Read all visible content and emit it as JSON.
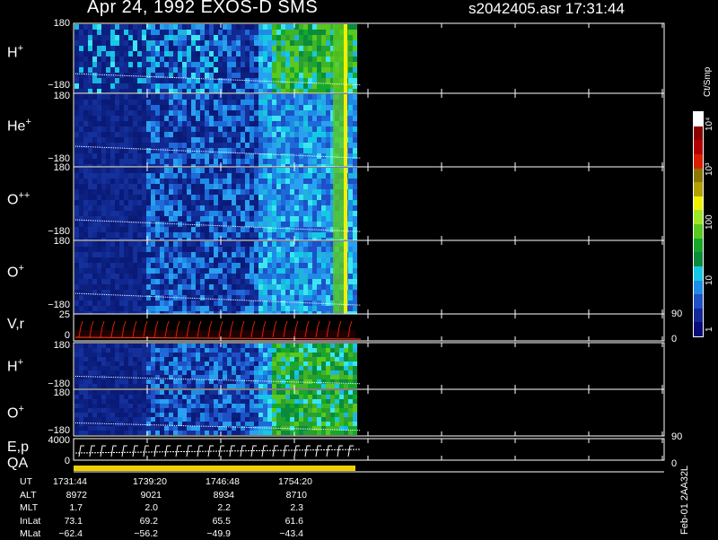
{
  "header": {
    "date_title": "Apr 24, 1992   EXOS-D SMS",
    "file_title": "s2042405.asr  17:31:44"
  },
  "panels": [
    {
      "label": "H",
      "sup": "+",
      "ytop": "180",
      "ybot": "−180"
    },
    {
      "label": "He",
      "sup": "+",
      "ytop": "180",
      "ybot": "−180"
    },
    {
      "label": "O",
      "sup": "++",
      "ytop": "180",
      "ybot": "−180"
    },
    {
      "label": "O",
      "sup": "+",
      "ytop": "180",
      "ybot": "−180"
    },
    {
      "label": "V,r",
      "sup": "",
      "ytop": "25",
      "ybot": "0",
      "rtop": "90",
      "rbot": "0"
    },
    {
      "label": "H",
      "sup": "+",
      "ytop": "180",
      "ybot": "−180"
    },
    {
      "label": "O",
      "sup": "+",
      "ytop": "180",
      "ybot": "−180"
    },
    {
      "label": "E,p",
      "sup": "",
      "ytop": "4000",
      "ybot": "0",
      "rtop": "90",
      "rbot": "0"
    }
  ],
  "qa_label": "QA",
  "ephemeris": {
    "rows": [
      {
        "label": "UT",
        "values": [
          "1731:44",
          "1739:20",
          "1746:48",
          "1754:20"
        ]
      },
      {
        "label": "ALT",
        "values": [
          "8972",
          "9021",
          "8934",
          "8710"
        ]
      },
      {
        "label": "MLT",
        "values": [
          "1.7",
          "2.0",
          "2.2",
          "2.3"
        ]
      },
      {
        "label": "InLat",
        "values": [
          "73.1",
          "69.2",
          "65.5",
          "61.6"
        ]
      },
      {
        "label": "MLat",
        "values": [
          "−62.4",
          "−56.2",
          "−49.9",
          "−43.4"
        ]
      }
    ]
  },
  "colorbar": {
    "unit": "Ct/Smp",
    "ticks": [
      "1",
      "10",
      "100",
      "10³",
      "10⁴"
    ],
    "colors": [
      "#0a0a78",
      "#14289a",
      "#1e50c8",
      "#1e8ce6",
      "#14c8e6",
      "#0a8c3c",
      "#16a82a",
      "#5ac81e",
      "#a0e628",
      "#f0f000",
      "#b4a000",
      "#8c7800",
      "#dc1e00",
      "#b40000",
      "#8c0000",
      "#ffffff"
    ]
  },
  "footer_vertical": "Feb-01 2AA32L",
  "chart_data": {
    "type": "heatmap",
    "title": "Apr 24, 1992   EXOS-D SMS",
    "x_time_labels": [
      "1731:44",
      "1739:20",
      "1746:48",
      "1754:20"
    ],
    "series": [
      {
        "name": "H+",
        "ylim": [
          -180,
          180
        ]
      },
      {
        "name": "He+",
        "ylim": [
          -180,
          180
        ]
      },
      {
        "name": "O++",
        "ylim": [
          -180,
          180
        ]
      },
      {
        "name": "O+",
        "ylim": [
          -180,
          180
        ]
      },
      {
        "name": "V,r",
        "ylim": [
          0,
          25
        ],
        "right_ylim": [
          0,
          90
        ]
      },
      {
        "name": "H+",
        "ylim": [
          -180,
          180
        ]
      },
      {
        "name": "O+",
        "ylim": [
          -180,
          180
        ]
      },
      {
        "name": "E,p",
        "ylim": [
          0,
          4000
        ],
        "right_ylim": [
          0,
          90
        ]
      }
    ],
    "colorbar_unit": "Ct/Smp",
    "colorbar_scale": "log",
    "colorbar_range": [
      1,
      10000
    ]
  }
}
